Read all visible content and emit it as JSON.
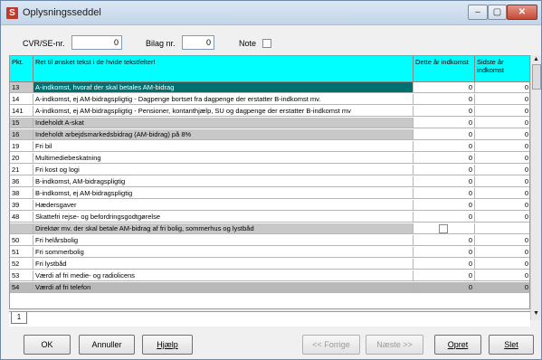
{
  "window": {
    "title": "Oplysningsseddel",
    "min": "–",
    "max": "▢",
    "close": "✕"
  },
  "form": {
    "cvr_label": "CVR/SE-nr.",
    "cvr_value": "0",
    "bilag_label": "Bilag nr.",
    "bilag_value": "0",
    "note_label": "Note"
  },
  "table": {
    "headers": {
      "pkt": "Pkt.",
      "text": "Ret til ønsket tekst i de hvide tekstfelter!",
      "dette": "Dette år indkomst",
      "sidste": "Sidste år indkomst"
    },
    "rows": [
      {
        "pkt": "13",
        "text": "A-indkomst, hvoraf der skal betales AM-bidrag",
        "dette": "0",
        "sidste": "0",
        "style": "sel"
      },
      {
        "pkt": "14",
        "text": "A-indkomst, ej AM-bidragspligtig - Dagpenge bortset fra dagpenge der erstatter B-indkomst mv.",
        "dette": "0",
        "sidste": "0",
        "style": ""
      },
      {
        "pkt": "141",
        "text": "A-indkomst, ej AM-bidragspligtig - Pensioner, kontanthjælp, SU og dagpenge der erstatter B-indkomst mv",
        "dette": "0",
        "sidste": "0",
        "style": ""
      },
      {
        "pkt": "15",
        "text": "Indeholdt A-skat",
        "dette": "0",
        "sidste": "0",
        "style": "grey"
      },
      {
        "pkt": "16",
        "text": "Indeholdt arbejdsmarkedsbidrag (AM-bidrag) på 8%",
        "dette": "0",
        "sidste": "0",
        "style": "grey"
      },
      {
        "pkt": "19",
        "text": "Fri bil",
        "dette": "0",
        "sidste": "0",
        "style": ""
      },
      {
        "pkt": "20",
        "text": "Multimediebeskatning",
        "dette": "0",
        "sidste": "0",
        "style": ""
      },
      {
        "pkt": "21",
        "text": "Fri kost og logi",
        "dette": "0",
        "sidste": "0",
        "style": ""
      },
      {
        "pkt": "36",
        "text": "B-indkomst, AM-bidragspligtig",
        "dette": "0",
        "sidste": "0",
        "style": ""
      },
      {
        "pkt": "38",
        "text": "B-indkomst, ej AM-bidragspligtig",
        "dette": "0",
        "sidste": "0",
        "style": ""
      },
      {
        "pkt": "39",
        "text": "Hædersgaver",
        "dette": "0",
        "sidste": "0",
        "style": ""
      },
      {
        "pkt": "48",
        "text": "Skattefri rejse- og befordringsgodtgørelse",
        "dette": "0",
        "sidste": "0",
        "style": ""
      },
      {
        "pkt": "",
        "text": "Direktør mv. der skal betale AM-bidrag af fri bolig, sommerhus og lystbåd",
        "dette": "",
        "sidste": "",
        "style": "grey check"
      },
      {
        "pkt": "50",
        "text": "Fri helårsbolig",
        "dette": "0",
        "sidste": "0",
        "style": ""
      },
      {
        "pkt": "51",
        "text": "Fri sommerbolig",
        "dette": "0",
        "sidste": "0",
        "style": ""
      },
      {
        "pkt": "52",
        "text": "Fri lystbåd",
        "dette": "0",
        "sidste": "0",
        "style": ""
      },
      {
        "pkt": "53",
        "text": "Værdi af fri medie- og radiolicens",
        "dette": "0",
        "sidste": "0",
        "style": ""
      },
      {
        "pkt": "54",
        "text": "Værdi af fri telefon",
        "dette": "0",
        "sidste": "0",
        "style": "dgrey"
      }
    ]
  },
  "tab": {
    "label": "1"
  },
  "buttons": {
    "ok": "OK",
    "annuller": "Annuller",
    "hjaelp": "Hjælp",
    "forrige": "<< Forrige",
    "naeste": "Næste >>",
    "opret": "Opret",
    "slet": "Slet"
  },
  "colors": {
    "header_bg": "#00ffff",
    "selected_bg": "#006f6f",
    "grey_row": "#c8c8c8"
  }
}
